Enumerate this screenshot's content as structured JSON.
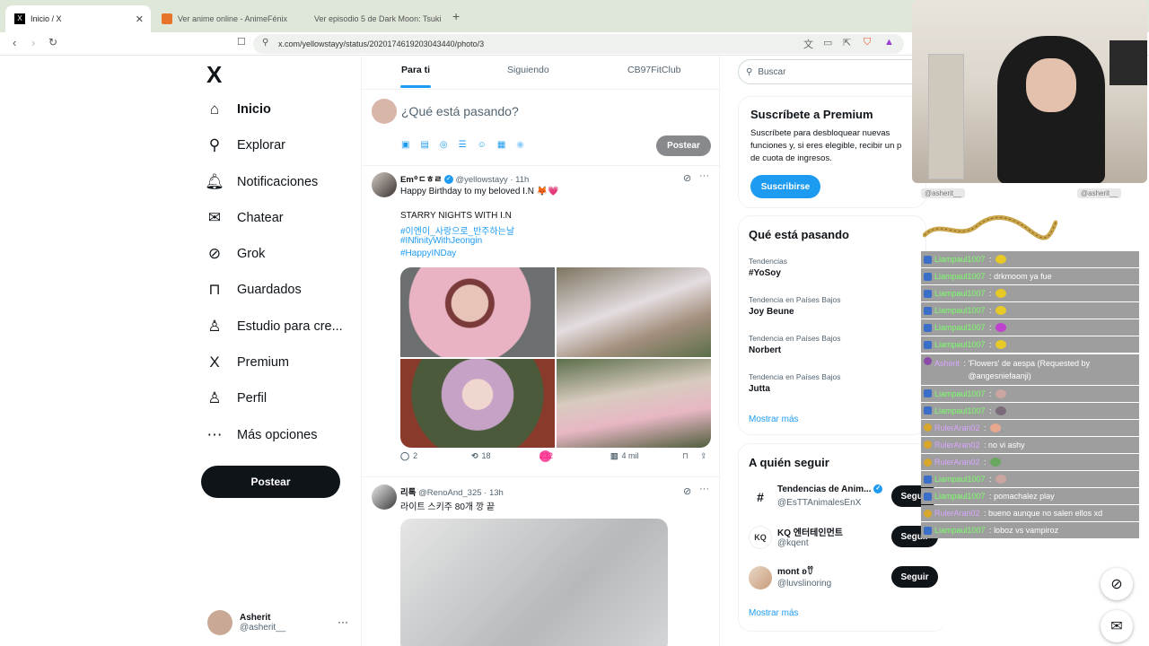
{
  "browser": {
    "tabs": [
      {
        "title": "Inicio / X",
        "close": "✕"
      },
      {
        "title": "Ver anime online - AnimeFénix"
      },
      {
        "title": "Ver episodio 5 de Dark Moon: Tsuki ..."
      }
    ],
    "new_tab": "+",
    "url": "x.com/yellowstayy/status/2020174619203043440/photo/3"
  },
  "nav": {
    "logo": "X",
    "items": [
      {
        "label": "Inicio",
        "icon": "home-icon"
      },
      {
        "label": "Explorar",
        "icon": "search-icon"
      },
      {
        "label": "Notificaciones",
        "icon": "bell-icon"
      },
      {
        "label": "Chatear",
        "icon": "mail-icon"
      },
      {
        "label": "Grok",
        "icon": "grok-icon"
      },
      {
        "label": "Guardados",
        "icon": "bookmark-icon"
      },
      {
        "label": "Estudio para cre...",
        "icon": "studio-icon"
      },
      {
        "label": "Premium",
        "icon": "x-icon"
      },
      {
        "label": "Perfil",
        "icon": "person-icon"
      },
      {
        "label": "Más opciones",
        "icon": "more-circle-icon"
      }
    ],
    "post_button": "Postear",
    "account": {
      "name": "Asherit",
      "handle": "@asherit__",
      "more": "···"
    }
  },
  "feed": {
    "tabs": [
      "Para ti",
      "Siguiendo",
      "CB97FitClub"
    ],
    "compose_placeholder": "¿Qué está pasando?",
    "compose_post": "Postear",
    "tweets": [
      {
        "name": "Em꙳ㄷㅎㄹ",
        "handle": "@yellowstayy",
        "time": "· 11h",
        "lines": [
          "Happy Birthday to my beloved I.N 🦊💗",
          "",
          "STARRY NIGHTS WITH I.N"
        ],
        "hashtags": [
          "#이엔이_사랑으로_반주하는날",
          "#INfinityWithJeongin",
          "#HappyINDay"
        ],
        "replies": "2",
        "retweets": "18",
        "likes": "232",
        "views": "4 mil"
      },
      {
        "name": "리톡",
        "handle": "@RenoAnd_325",
        "time": "· 13h",
        "text": "라이트 스키주 80개 깡 끝"
      }
    ]
  },
  "sidebar": {
    "search_placeholder": "Buscar",
    "premium": {
      "title": "Suscríbete a Premium",
      "text": [
        "Suscríbete para desbloquear nuevas",
        "funciones y, si eres elegible, recibir un p",
        "de cuota de ingresos."
      ],
      "button": "Suscribirse"
    },
    "trends": {
      "title": "Qué está pasando",
      "items": [
        {
          "context": "Tendencias",
          "name": "#YoSoy"
        },
        {
          "context": "Tendencia en Países Bajos",
          "name": "Joy Beune"
        },
        {
          "context": "Tendencia en Países Bajos",
          "name": "Norbert"
        },
        {
          "context": "Tendencia en Países Bajos",
          "name": "Jutta"
        }
      ],
      "more": "Mostrar más"
    },
    "follow": {
      "title": "A quién seguir",
      "items": [
        {
          "name": "Tendencias de Anim...",
          "handle": "@EsTTAnimalesEnX",
          "button": "Seguir",
          "avatar": "#"
        },
        {
          "name": "KQ 엔터테인먼트",
          "handle": "@kqent",
          "button": "Seguir",
          "avatar": "KQ"
        },
        {
          "name": "mont ʚꀎ",
          "handle": "@luvslinoring",
          "button": "Seguir",
          "avatar": ""
        }
      ],
      "more": "Mostrar más"
    }
  },
  "stream": {
    "mini_labels": [
      "@asherit__",
      "@asherit__"
    ],
    "chat": [
      {
        "user": "Liampaul1007",
        "sep": " : ",
        "msg": "",
        "badge": "blue",
        "emote": "#e7c927"
      },
      {
        "user": "Liampaul1007",
        "sep": " : ",
        "msg": "drkmoom ya fue",
        "badge": "blue"
      },
      {
        "user": "Liampaul1007",
        "sep": " : ",
        "msg": "",
        "badge": "blue",
        "emote": "#e7c927"
      },
      {
        "user": "Liampaul1007",
        "sep": " : ",
        "msg": "",
        "badge": "blue",
        "emote": "#e7c927"
      },
      {
        "user": "Liampaul1007",
        "sep": " : ",
        "msg": "",
        "badge": "blue",
        "emote": "#c040d0"
      },
      {
        "user": "Liampaul1007",
        "sep": " : ",
        "msg": "",
        "badge": "blue",
        "emote": "#e7c927"
      },
      {
        "user": "Asherit",
        "sep": " : ",
        "msg": "'Flowers' de aespa (Requested by @angesniefaanji)",
        "badge": "purple",
        "tall": true
      },
      {
        "user": "Liampaul1007",
        "sep": " : ",
        "msg": "",
        "badge": "blue",
        "emote": "#c9a6a0"
      },
      {
        "user": "Liampaul1007",
        "sep": " : ",
        "msg": "",
        "badge": "blue",
        "emote": "#7a6a7a"
      },
      {
        "user": "RulerAran02",
        "sep": " : ",
        "msg": "",
        "badge": "gold",
        "emote": "#e8a890"
      },
      {
        "user": "RulerAran02",
        "sep": " : ",
        "msg": "no vi ashy",
        "badge": "gold"
      },
      {
        "user": "RulerAran02",
        "sep": " : ",
        "msg": "",
        "badge": "gold",
        "emote": "#6aa860"
      },
      {
        "user": "Liampaul1007",
        "sep": " : ",
        "msg": "",
        "badge": "blue",
        "emote": "#c9a6a0"
      },
      {
        "user": "Liampaul1007",
        "sep": " : ",
        "msg": "pomachalez play",
        "badge": "blue"
      },
      {
        "user": "RulerAran02",
        "sep": " : ",
        "msg": "bueno aunque no salen ellos xd",
        "badge": "gold"
      },
      {
        "user": "Liampaul1007",
        "sep": " : ",
        "msg": "loboz vs vampiroz",
        "badge": "blue"
      }
    ]
  },
  "colors": {
    "accent": "#1d9bf0",
    "like": "#f91880",
    "dark": "#0f1419"
  }
}
